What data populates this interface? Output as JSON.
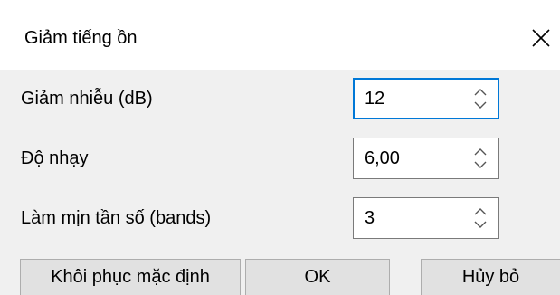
{
  "dialog": {
    "title": "Giảm tiếng ồn",
    "close_icon": "close-icon"
  },
  "fields": [
    {
      "label": "Giảm nhiễu (dB)",
      "value": "12"
    },
    {
      "label": "Độ nhạy",
      "value": "6,00"
    },
    {
      "label": "Làm mịn tần số (bands)",
      "value": "3"
    }
  ],
  "buttons": {
    "reset": "Khôi phục mặc định",
    "ok": "OK",
    "cancel": "Hủy bỏ"
  },
  "colors": {
    "focus_border": "#0078d7",
    "dialog_bg": "#f0f0f0",
    "titlebar_bg": "#ffffff"
  }
}
